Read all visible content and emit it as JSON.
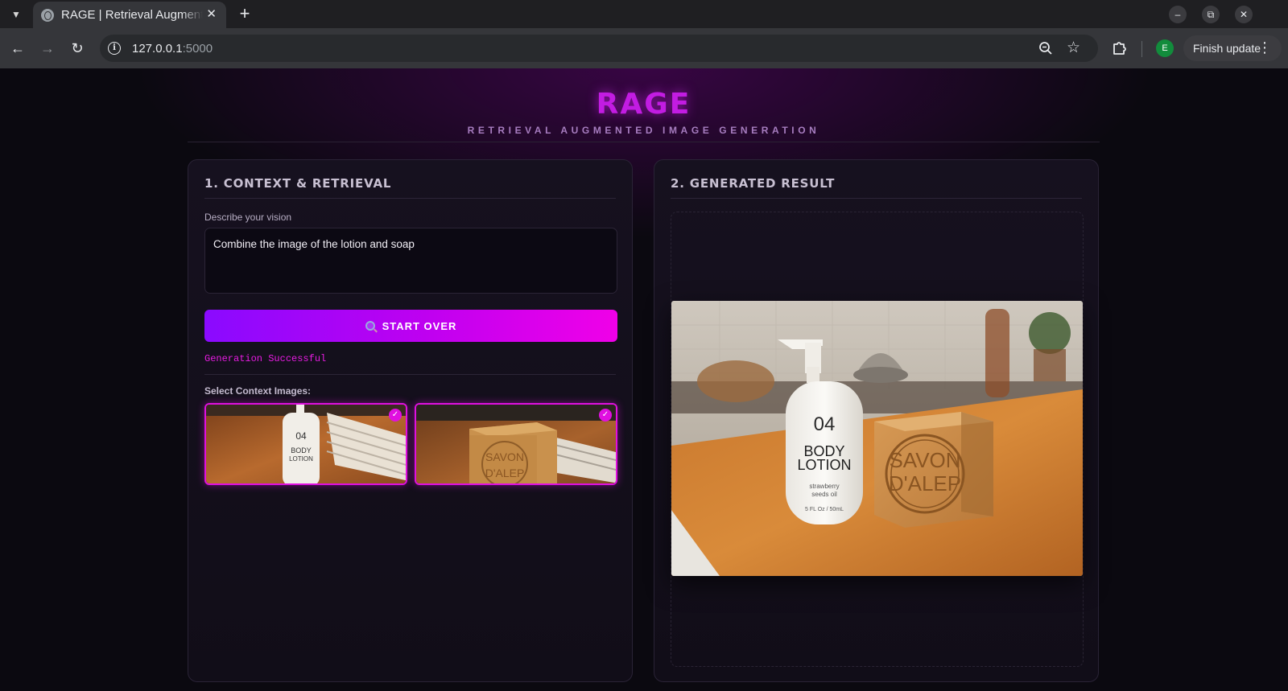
{
  "browser": {
    "tab_title": "RAGE | Retrieval Augmented Image Generation",
    "url_host": "127.0.0.1",
    "url_port": ":5000",
    "finish_update": "Finish update",
    "profile_initial": "E",
    "profile_color": "#128c3c"
  },
  "header": {
    "logo": "RAGE",
    "subtitle": "RETRIEVAL AUGMENTED IMAGE GENERATION"
  },
  "left_panel": {
    "title": "1. CONTEXT & RETRIEVAL",
    "vision_label": "Describe your vision",
    "vision_value": "Combine the image of the lotion and soap",
    "start_button": "START OVER",
    "status": "Generation Successful",
    "context_label": "Select Context Images:",
    "thumbnails": [
      {
        "bottle_number": "04",
        "bottle_line1": "BODY",
        "bottle_line2": "LOTION",
        "selected": true
      },
      {
        "soap_line1": "SAVON",
        "soap_line2": "D'ALEP",
        "selected": true
      }
    ]
  },
  "right_panel": {
    "title": "2. GENERATED RESULT",
    "bottle_number": "04",
    "bottle_line1": "BODY",
    "bottle_line2": "LOTION",
    "bottle_small1": "strawberry",
    "bottle_small2": "seeds oil",
    "bottle_small3": "5 FL Oz / 50mL",
    "soap_line1": "SAVON",
    "soap_line2": "D'ALEP"
  },
  "colors": {
    "accent": "#e010e0",
    "logo": "#c21ce2",
    "button_start": "#8a0aff",
    "button_end": "#f000e8",
    "status": "#e81ce2"
  }
}
